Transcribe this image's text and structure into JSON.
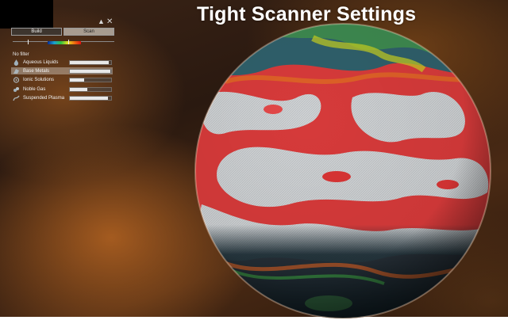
{
  "overlay": {
    "title": "Tight Scanner Settings"
  },
  "panel": {
    "controls": {
      "lock_glyph": "▲",
      "close_glyph": "✕"
    },
    "tabs": [
      {
        "label": "Build",
        "active": false
      },
      {
        "label": "Scan",
        "active": true
      }
    ],
    "scale": {
      "marker_left": 0.15,
      "marker_right": 0.55
    },
    "filter_label": "No filter",
    "resources": [
      {
        "label": "Aqueous Liquids",
        "icon": "liquid-icon",
        "level": 0.95,
        "selected": false
      },
      {
        "label": "Base Metals",
        "icon": "metal-icon",
        "level": 0.98,
        "selected": true
      },
      {
        "label": "Ionic Solutions",
        "icon": "ionic-icon",
        "level": 0.35,
        "selected": false
      },
      {
        "label": "Noble Gas",
        "icon": "gas-icon",
        "level": 0.42,
        "selected": false
      },
      {
        "label": "Suspended Plasma",
        "icon": "plasma-icon",
        "level": 0.92,
        "selected": false
      }
    ]
  }
}
